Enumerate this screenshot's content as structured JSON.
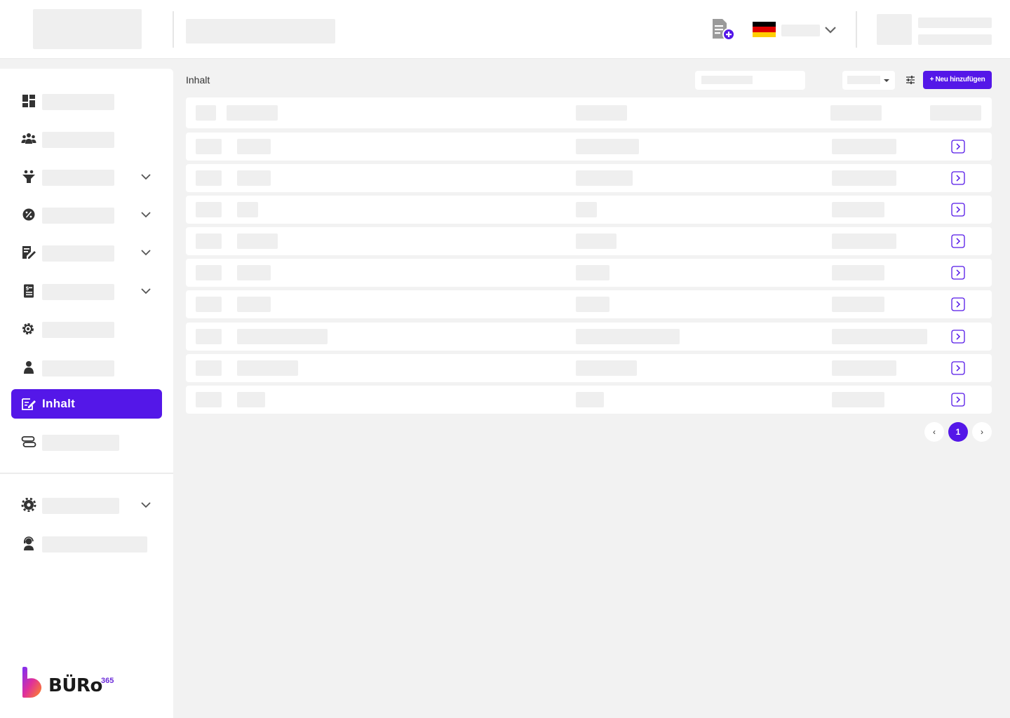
{
  "header": {
    "add_document_icon": "file-add-icon",
    "language_flag": "flag-germany",
    "flag_colors": [
      "#000000",
      "#dd0000",
      "#ffce00"
    ]
  },
  "sidebar": {
    "items": [
      {
        "icon": "dashboard-icon"
      },
      {
        "icon": "users-icon"
      },
      {
        "icon": "funnel-icon",
        "expandable": true
      },
      {
        "icon": "percent-badge-icon",
        "expandable": true
      },
      {
        "icon": "document-edit-icon",
        "expandable": true
      },
      {
        "icon": "invoice-icon",
        "expandable": true
      },
      {
        "icon": "settings-cog-icon"
      },
      {
        "icon": "person-icon"
      },
      {
        "icon": "content-edit-icon",
        "label": "Inhalt",
        "active": true
      },
      {
        "icon": "route-icon"
      }
    ],
    "bottom_items": [
      {
        "icon": "gear-icon",
        "expandable": true
      },
      {
        "icon": "support-agent-icon"
      }
    ],
    "logo": {
      "text": "BÜRo",
      "superscript": "365"
    }
  },
  "content": {
    "title": "Inhalt",
    "new_button_label": "+ Neu hinzufügen",
    "filter_icon": "sliders-icon"
  },
  "table": {
    "row_count": 9
  },
  "pagination": {
    "prev": "‹",
    "current": "1",
    "next": "›"
  },
  "colors": {
    "accent": "#5417e8",
    "skeleton": "#efefef",
    "background": "#f2f2f2"
  }
}
